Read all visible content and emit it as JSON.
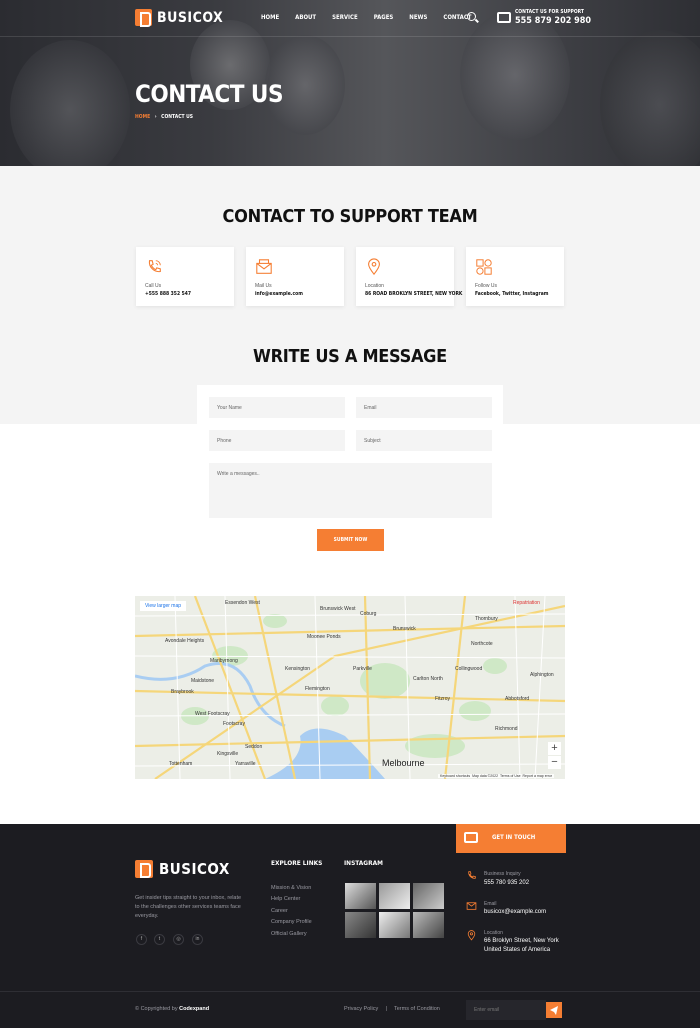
{
  "header": {
    "brand": "BUSICOX",
    "nav": [
      "HOME",
      "ABOUT",
      "SERVICE",
      "PAGES",
      "NEWS",
      "CONTACT"
    ],
    "support_label": "CONTACT US FOR SUPPORT",
    "support_phone": "555 879 202 980"
  },
  "hero": {
    "title": "CONTACT US",
    "breadcrumb_home": "HOME",
    "breadcrumb_sep": "›",
    "breadcrumb_current": "CONTACT US"
  },
  "support": {
    "title": "CONTACT TO SUPPORT TEAM",
    "cards": [
      {
        "icon": "phone-icon",
        "label": "Call Us",
        "value": "+555 888 352 547"
      },
      {
        "icon": "mail-icon",
        "label": "Mail Us",
        "value": "info@example.com"
      },
      {
        "icon": "location-icon",
        "label": "Location",
        "value": "86 ROAD BROKLYN STREET, NEW YORK"
      },
      {
        "icon": "share-icon",
        "label": "Follow Us",
        "value": "Facebook, Twitter, Instagram"
      }
    ]
  },
  "form": {
    "title": "WRITE US A MESSAGE",
    "name_placeholder": "Your Name",
    "email_placeholder": "Email",
    "phone_placeholder": "Phone",
    "subject_placeholder": "Subject",
    "message_placeholder": "Write a messages..",
    "submit": "SUBMIT NOW"
  },
  "map": {
    "larger_link": "View larger map",
    "city": "Melbourne",
    "labels": [
      "Essendon West",
      "Brunswick West",
      "Brunswick",
      "Thornbury",
      "Avondale Heights",
      "Moonee Ponds",
      "Coburg",
      "Northcote",
      "Maribyrnong",
      "Parkville",
      "Carlton North",
      "Alphington",
      "Maidstone",
      "Braybrook",
      "Flemington",
      "Fitzroy",
      "Footscray",
      "Seddon",
      "Kingsville",
      "Tottenham",
      "Yarraville",
      "Richmond",
      "Kensington",
      "West Footscray",
      "Collingwood",
      "Abbotsford"
    ],
    "footer": [
      "Keyboard shortcuts",
      "Map data ©2022",
      "Terms of Use",
      "Report a map error"
    ],
    "zoom_in": "+",
    "zoom_out": "−",
    "corner_label": "Repatriation"
  },
  "footer": {
    "get_in_touch": "GET IN TOUCH",
    "brand": "BUSICOX",
    "description": "Get insider tips straight to your inbox, relate to the challenges other services teams face everyday.",
    "social": [
      "f",
      "t",
      "◎",
      "in"
    ],
    "explore_title": "EXPLORE LINKS",
    "links": [
      "Mission & Vision",
      "Help Center",
      "Career",
      "Company Profile",
      "Official Gallery"
    ],
    "instagram_title": "INSTAGRAM",
    "contact": [
      {
        "icon": "phone-icon",
        "label": "Business Inquiry",
        "lines": [
          "555 780 935 202"
        ]
      },
      {
        "icon": "mail-icon",
        "label": "Email",
        "lines": [
          "busicox@example.com"
        ]
      },
      {
        "icon": "location-icon",
        "label": "Location",
        "lines": [
          "66 Broklyn Street, New York",
          "United States of America"
        ]
      }
    ],
    "copyright_prefix": "© Copyrighted by ",
    "copyright_brand": "Codexpand",
    "privacy": "Privacy Policy",
    "sep": "|",
    "terms": "Terms of Condition",
    "newsletter_placeholder": "Enter email"
  },
  "colors": {
    "accent": "#f57e33",
    "dark": "#1c1c21",
    "grey": "#f4f4f4"
  }
}
